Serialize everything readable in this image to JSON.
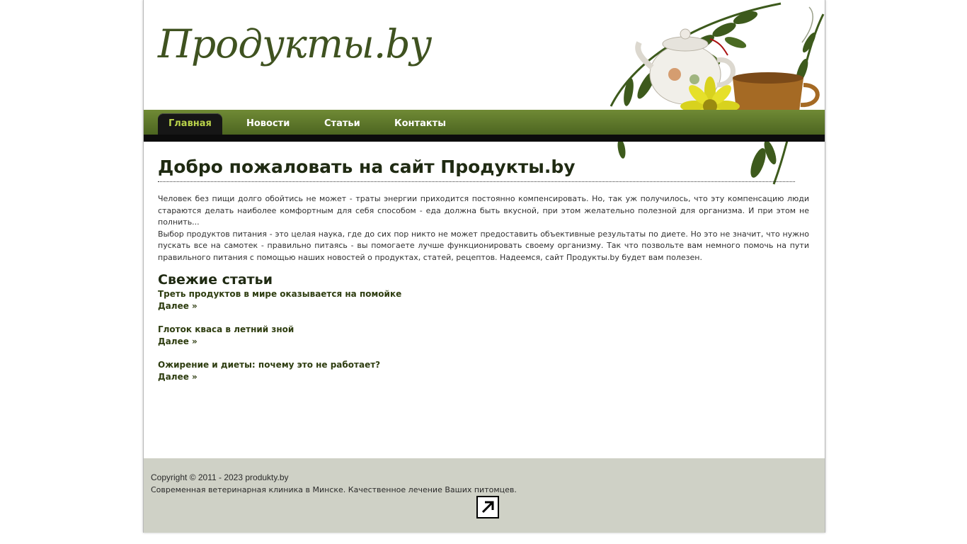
{
  "site": {
    "logo": "Продукты.by"
  },
  "nav": {
    "items": [
      {
        "label": "Главная",
        "active": true
      },
      {
        "label": "Новости"
      },
      {
        "label": "Статьи"
      },
      {
        "label": "Контакты"
      }
    ]
  },
  "main": {
    "title": "Добро пожаловать на сайт Продукты.by",
    "intro": [
      "Человек без пищи долго обойтись не может - траты энергии приходится постоянно компенсировать. Но, так уж получилось, что эту компенсацию люди стараются делать наиболее комфортным для себя способом - еда должна быть вкусной, при этом желательно полезной для организма. И при этом не полнить...",
      "Выбор продуктов питания - это целая наука, где до сих пор никто не может предоставить объективные результаты по диете. Но это не значит, что нужно пускать все на самотек - правильно питаясь - вы помогаете лучше функционировать своему организму. Так что позвольте вам немного помочь на пути правильного питания с помощью наших новостей о продуктах, статей, рецептов. Надеемся, сайт Продукты.by будет вам полезен."
    ],
    "fresh_title": "Свежие статьи",
    "more_label": "Далее »",
    "articles": [
      {
        "title": "Треть продуктов в мире оказывается на помойке"
      },
      {
        "title": "Глоток кваса в летний зной"
      },
      {
        "title": "Ожирение и диеты: почему это не работает?"
      }
    ]
  },
  "footer": {
    "copyright": "Copyright © 2011 - 2023 produkty.by",
    "text": "Современная ветеринарная клиника в Минске. Качественное лечение Ваших питомцев.",
    "counter_icon": "arrow-up-right-icon"
  },
  "colors": {
    "nav_green": "#5a7228",
    "nav_active_text": "#b9d24a",
    "footer_bg": "#cfd1c6",
    "logo": "#3f5220"
  }
}
